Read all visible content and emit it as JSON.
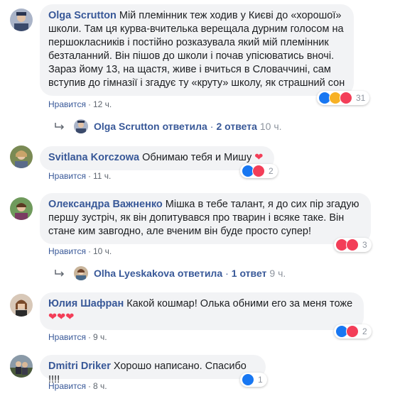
{
  "like_label": "Нравится",
  "comments": [
    {
      "author": "Olga Scrutton",
      "text": "Мій племінник теж ходив у Києві до «хорошої» школи. Там ця курва-вчителька верещала дурним голосом на першокласників і постійно розказувала який мій племінник безталанний. Він пішов до школи і почав упісюватись вночі. Зараз йому 13, на щастя, живе і вчиться в Словаччині, сам вступив до гімназії і згадує ту «круту» школу, як страшний сон",
      "time": "12 ч.",
      "reaction_count": "31",
      "reactions": [
        "like-reaction-icon",
        "sad-reaction-icon",
        "love-reaction-icon"
      ],
      "reply": {
        "name": "Olga Scrutton",
        "verb": "ответила",
        "count": "2 ответа",
        "time": "10 ч."
      }
    },
    {
      "author": "Svitlana Korczowa",
      "text": "Обнимаю тебя и Мишу",
      "time": "11 ч.",
      "reaction_count": "2",
      "reactions": [
        "like-reaction-icon",
        "love-reaction-icon"
      ]
    },
    {
      "author": "Олександра Важненко",
      "text": "Мішка в тебе талант, я до сих пір згадую першу зустріч, як він допитувався про тварин і всяке таке. Він стане ким завгодно, але вченим він буде просто супер!",
      "time": "10 ч.",
      "reaction_count": "3",
      "reactions": [
        "love-reaction-icon",
        "love-reaction-icon"
      ],
      "reply": {
        "name": "Olha Lyeskakova",
        "verb": "ответила",
        "count": "1 ответ",
        "time": "9 ч."
      }
    },
    {
      "author": "Юлия Шафран",
      "text": "Какой кошмар! Олька обними его за меня тоже",
      "time": "9 ч.",
      "reaction_count": "2",
      "reactions": [
        "like-reaction-icon",
        "love-reaction-icon"
      ]
    },
    {
      "author": "Dmitri Driker",
      "text": "Хорошо написано. Спасибо !!!!",
      "time": "8 ч.",
      "reaction_count": "1",
      "reactions": [
        "like-reaction-icon"
      ]
    }
  ],
  "colors": {
    "link": "#385898",
    "bubble": "#f2f3f5",
    "like": "#1877f2",
    "love": "#f33e58",
    "sad": "#f7b125"
  }
}
